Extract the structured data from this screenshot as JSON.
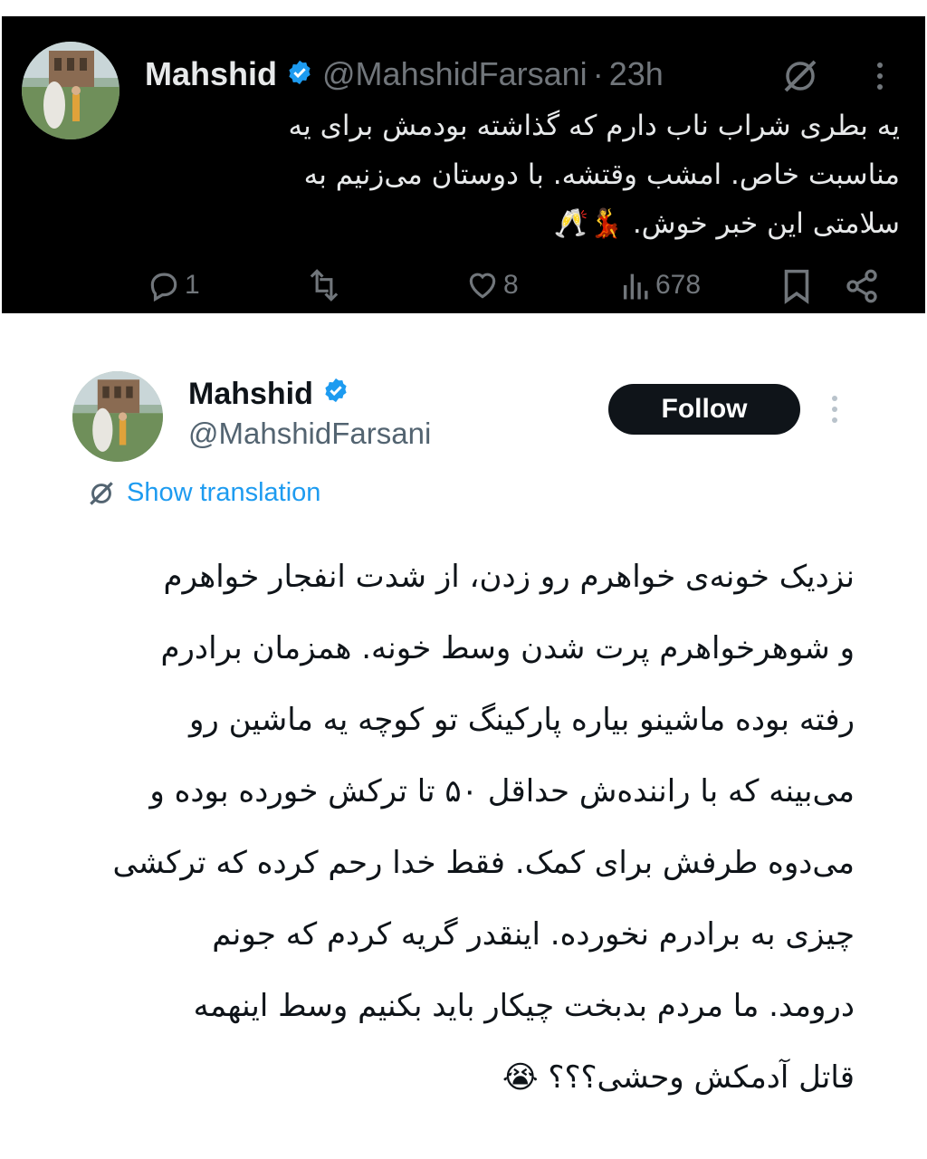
{
  "top_tweet": {
    "name": "Mahshid",
    "handle": "@MahshidFarsani",
    "separator": "·",
    "time": "23h",
    "text_lines": [
      "یه بطری شراب ناب دارم که گذاشته بودمش برای یه",
      "مناسبت خاص. امشب وقتشه. با دوستان می‌زنیم به",
      "سلامتی این خبر خوش. 💃🥂"
    ],
    "replies": "1",
    "likes": "8",
    "views": "678"
  },
  "main_tweet": {
    "name": "Mahshid",
    "handle": "@MahshidFarsani",
    "follow_label": "Follow",
    "translate_label": "Show translation",
    "text_lines": [
      "نزدیک خونه‌ی خواهرم رو زدن، از شدت انفجار خواهرم",
      "و شوهرخواهرم پرت شدن وسط خونه. همزمان برادرم",
      "رفته بوده ماشینو بیاره پارکینگ تو کوچه یه ماشین رو",
      "می‌بینه که با راننده‌ش حداقل ۵۰ تا ترکش خورده بوده و",
      "می‌دوه طرفش برای کمک. فقط خدا رحم کرده که ترکشی",
      "چیزی به برادرم نخورده. اینقدر گریه کردم که جونم",
      "درومد. ما مردم بدبخت چیکار باید بکنیم وسط اینهمه",
      "قاتل آدمکش وحشی؟؟؟ 😭"
    ]
  },
  "colors": {
    "dark_bg": "#000000",
    "light_bg": "#ffffff",
    "verified": "#1d9bf0",
    "muted": "#71767b",
    "link": "#1d9bf0"
  },
  "icons": [
    "verified-badge-icon",
    "grok-icon",
    "more-icon",
    "reply-icon",
    "repost-icon",
    "like-icon",
    "views-icon",
    "bookmark-icon",
    "share-icon",
    "translate-icon"
  ]
}
